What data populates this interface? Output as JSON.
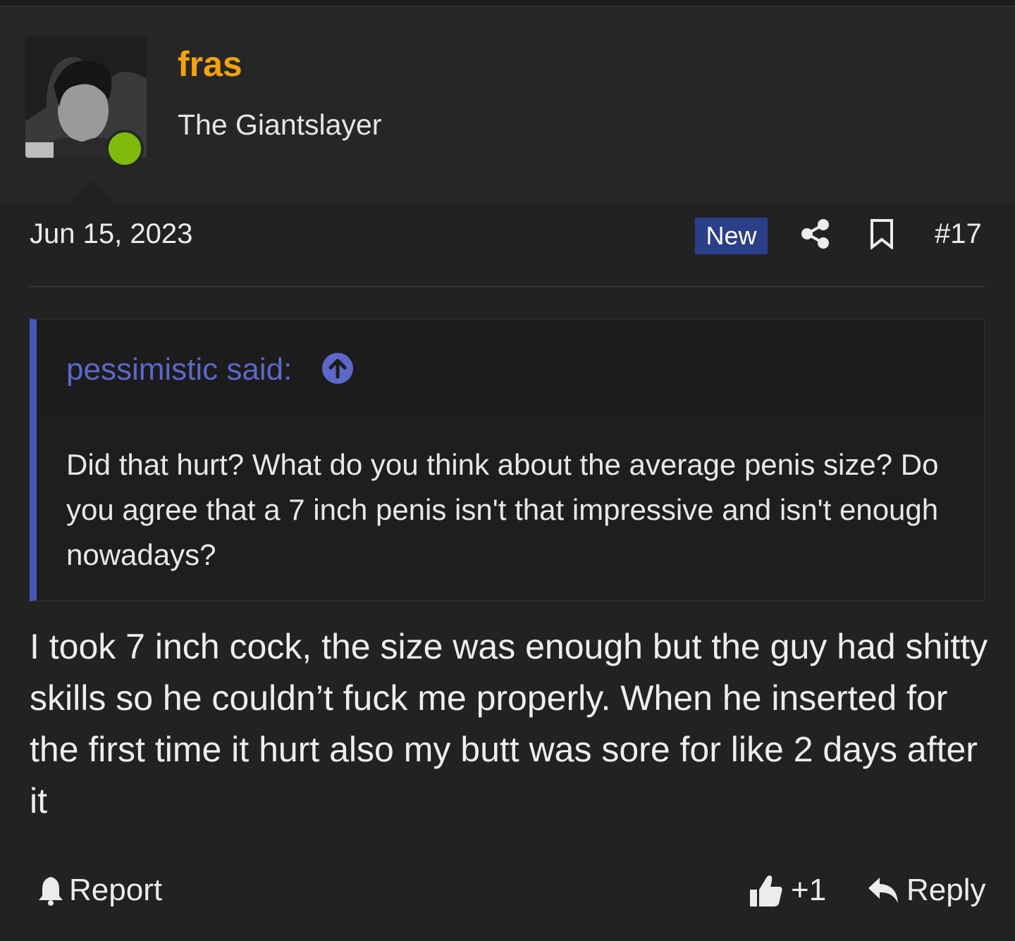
{
  "user": {
    "username": "fras",
    "title": "The Giantslayer",
    "online": true
  },
  "post": {
    "date": "Jun 15, 2023",
    "badge": "New",
    "number": "#17",
    "body": "I took 7 inch cock, the size was enough but the guy had shitty skills so he couldn’t fuck me properly. When he inserted for the first time it hurt also my butt was sore for like 2 days after it"
  },
  "quote": {
    "author_line": "pessimistic said:",
    "text": "Did that hurt? What do you think about the average penis size? Do you agree that a 7 inch penis isn't that impressive and isn't enough nowadays?"
  },
  "actions": {
    "report": "Report",
    "like_count": "+1",
    "reply": "Reply"
  },
  "colors": {
    "background": "#222222",
    "username": "#f4a20e",
    "online_dot": "#7fba0c",
    "new_badge": "#2b3e8a",
    "quote_accent": "#4a55b5",
    "quote_author": "#5c68c9"
  },
  "icons": [
    "share-icon",
    "bookmark-icon",
    "arrow-up-circle-icon",
    "bell-icon",
    "thumbs-up-icon",
    "reply-icon"
  ]
}
